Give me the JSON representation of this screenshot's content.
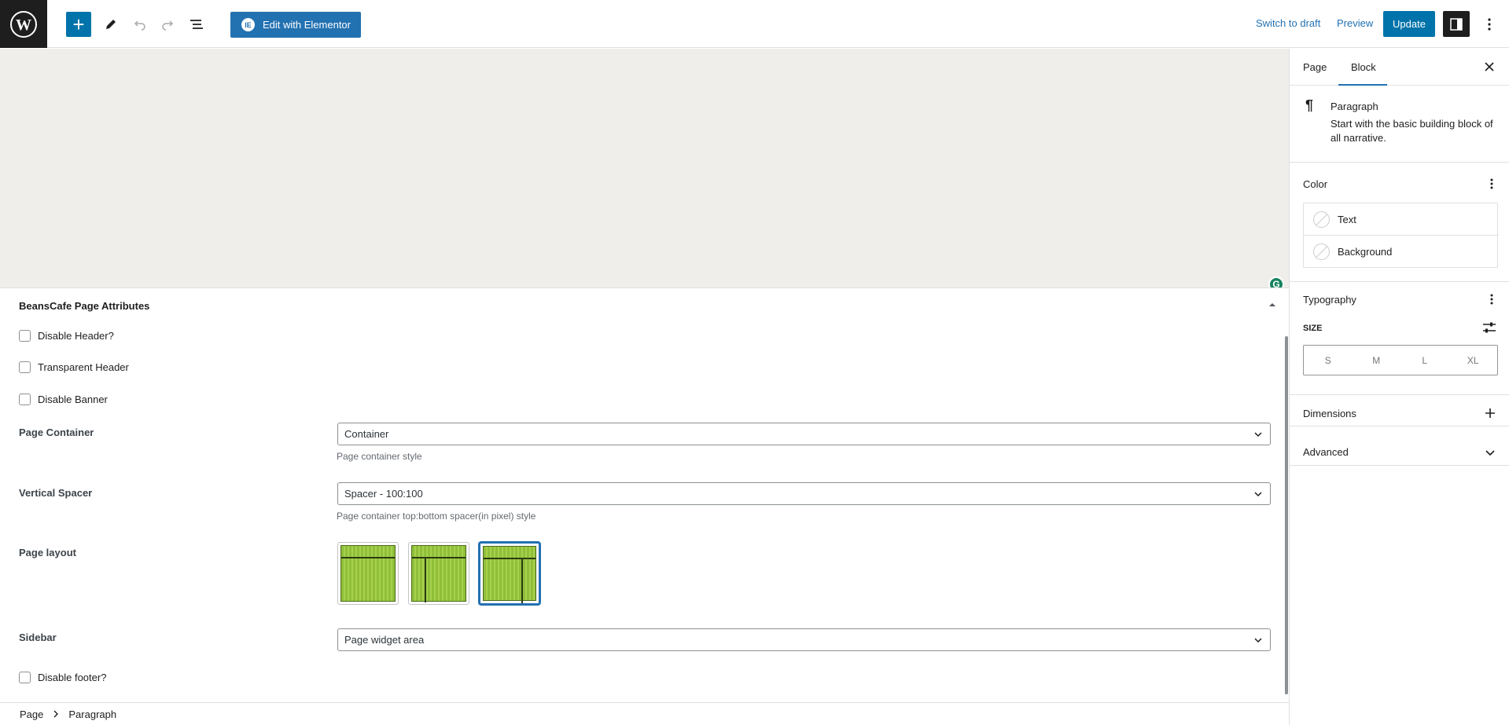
{
  "toolbar": {
    "elementor_label": "Edit with Elementor",
    "switch_draft": "Switch to draft",
    "preview": "Preview",
    "update": "Update"
  },
  "meta_box": {
    "title": "BeansCafe Page Attributes",
    "checkboxes": [
      {
        "label": "Disable Header?",
        "checked": false
      },
      {
        "label": "Transparent Header",
        "checked": false
      },
      {
        "label": "Disable Banner",
        "checked": false
      }
    ],
    "page_container": {
      "label": "Page Container",
      "value": "Container",
      "help": "Page container style"
    },
    "vertical_spacer": {
      "label": "Vertical Spacer",
      "value": "Spacer - 100:100",
      "help": "Page container top:bottom spacer(in pixel) style"
    },
    "page_layout": {
      "label": "Page layout",
      "selected_index": 2
    },
    "sidebar": {
      "label": "Sidebar",
      "value": "Page widget area"
    },
    "disable_footer": {
      "label": "Disable footer?",
      "checked": false
    }
  },
  "breadcrumb": {
    "root": "Page",
    "current": "Paragraph"
  },
  "inspector": {
    "tabs": [
      "Page",
      "Block"
    ],
    "active_tab": "Block",
    "block": {
      "title": "Paragraph",
      "description": "Start with the basic building block of all narrative."
    },
    "color": {
      "title": "Color",
      "items": [
        "Text",
        "Background"
      ]
    },
    "typography": {
      "title": "Typography",
      "size_label": "SIZE",
      "sizes": [
        "S",
        "M",
        "L",
        "XL"
      ]
    },
    "dimensions": "Dimensions",
    "advanced": "Advanced"
  },
  "colors": {
    "accent": "#2271b1",
    "wp_blue": "#0073aa",
    "canvas": "#f0eeea"
  }
}
